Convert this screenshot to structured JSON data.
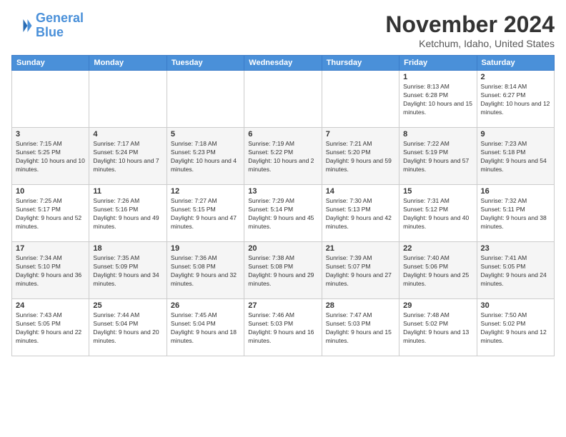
{
  "header": {
    "logo_line1": "General",
    "logo_line2": "Blue",
    "month_year": "November 2024",
    "location": "Ketchum, Idaho, United States"
  },
  "weekdays": [
    "Sunday",
    "Monday",
    "Tuesday",
    "Wednesday",
    "Thursday",
    "Friday",
    "Saturday"
  ],
  "weeks": [
    [
      {
        "day": "",
        "info": ""
      },
      {
        "day": "",
        "info": ""
      },
      {
        "day": "",
        "info": ""
      },
      {
        "day": "",
        "info": ""
      },
      {
        "day": "",
        "info": ""
      },
      {
        "day": "1",
        "info": "Sunrise: 8:13 AM\nSunset: 6:28 PM\nDaylight: 10 hours and 15 minutes."
      },
      {
        "day": "2",
        "info": "Sunrise: 8:14 AM\nSunset: 6:27 PM\nDaylight: 10 hours and 12 minutes."
      }
    ],
    [
      {
        "day": "3",
        "info": "Sunrise: 7:15 AM\nSunset: 5:25 PM\nDaylight: 10 hours and 10 minutes."
      },
      {
        "day": "4",
        "info": "Sunrise: 7:17 AM\nSunset: 5:24 PM\nDaylight: 10 hours and 7 minutes."
      },
      {
        "day": "5",
        "info": "Sunrise: 7:18 AM\nSunset: 5:23 PM\nDaylight: 10 hours and 4 minutes."
      },
      {
        "day": "6",
        "info": "Sunrise: 7:19 AM\nSunset: 5:22 PM\nDaylight: 10 hours and 2 minutes."
      },
      {
        "day": "7",
        "info": "Sunrise: 7:21 AM\nSunset: 5:20 PM\nDaylight: 9 hours and 59 minutes."
      },
      {
        "day": "8",
        "info": "Sunrise: 7:22 AM\nSunset: 5:19 PM\nDaylight: 9 hours and 57 minutes."
      },
      {
        "day": "9",
        "info": "Sunrise: 7:23 AM\nSunset: 5:18 PM\nDaylight: 9 hours and 54 minutes."
      }
    ],
    [
      {
        "day": "10",
        "info": "Sunrise: 7:25 AM\nSunset: 5:17 PM\nDaylight: 9 hours and 52 minutes."
      },
      {
        "day": "11",
        "info": "Sunrise: 7:26 AM\nSunset: 5:16 PM\nDaylight: 9 hours and 49 minutes."
      },
      {
        "day": "12",
        "info": "Sunrise: 7:27 AM\nSunset: 5:15 PM\nDaylight: 9 hours and 47 minutes."
      },
      {
        "day": "13",
        "info": "Sunrise: 7:29 AM\nSunset: 5:14 PM\nDaylight: 9 hours and 45 minutes."
      },
      {
        "day": "14",
        "info": "Sunrise: 7:30 AM\nSunset: 5:13 PM\nDaylight: 9 hours and 42 minutes."
      },
      {
        "day": "15",
        "info": "Sunrise: 7:31 AM\nSunset: 5:12 PM\nDaylight: 9 hours and 40 minutes."
      },
      {
        "day": "16",
        "info": "Sunrise: 7:32 AM\nSunset: 5:11 PM\nDaylight: 9 hours and 38 minutes."
      }
    ],
    [
      {
        "day": "17",
        "info": "Sunrise: 7:34 AM\nSunset: 5:10 PM\nDaylight: 9 hours and 36 minutes."
      },
      {
        "day": "18",
        "info": "Sunrise: 7:35 AM\nSunset: 5:09 PM\nDaylight: 9 hours and 34 minutes."
      },
      {
        "day": "19",
        "info": "Sunrise: 7:36 AM\nSunset: 5:08 PM\nDaylight: 9 hours and 32 minutes."
      },
      {
        "day": "20",
        "info": "Sunrise: 7:38 AM\nSunset: 5:08 PM\nDaylight: 9 hours and 29 minutes."
      },
      {
        "day": "21",
        "info": "Sunrise: 7:39 AM\nSunset: 5:07 PM\nDaylight: 9 hours and 27 minutes."
      },
      {
        "day": "22",
        "info": "Sunrise: 7:40 AM\nSunset: 5:06 PM\nDaylight: 9 hours and 25 minutes."
      },
      {
        "day": "23",
        "info": "Sunrise: 7:41 AM\nSunset: 5:05 PM\nDaylight: 9 hours and 24 minutes."
      }
    ],
    [
      {
        "day": "24",
        "info": "Sunrise: 7:43 AM\nSunset: 5:05 PM\nDaylight: 9 hours and 22 minutes."
      },
      {
        "day": "25",
        "info": "Sunrise: 7:44 AM\nSunset: 5:04 PM\nDaylight: 9 hours and 20 minutes."
      },
      {
        "day": "26",
        "info": "Sunrise: 7:45 AM\nSunset: 5:04 PM\nDaylight: 9 hours and 18 minutes."
      },
      {
        "day": "27",
        "info": "Sunrise: 7:46 AM\nSunset: 5:03 PM\nDaylight: 9 hours and 16 minutes."
      },
      {
        "day": "28",
        "info": "Sunrise: 7:47 AM\nSunset: 5:03 PM\nDaylight: 9 hours and 15 minutes."
      },
      {
        "day": "29",
        "info": "Sunrise: 7:48 AM\nSunset: 5:02 PM\nDaylight: 9 hours and 13 minutes."
      },
      {
        "day": "30",
        "info": "Sunrise: 7:50 AM\nSunset: 5:02 PM\nDaylight: 9 hours and 12 minutes."
      }
    ]
  ]
}
